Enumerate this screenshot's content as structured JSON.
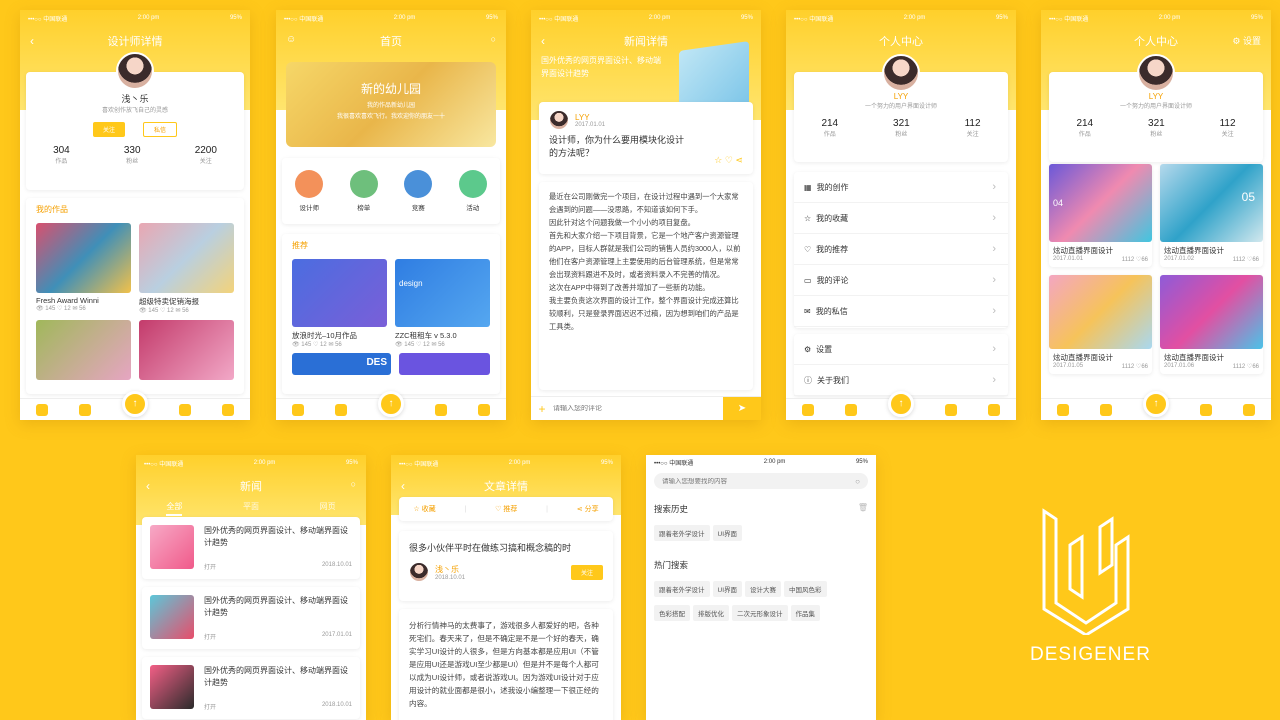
{
  "status": {
    "carrier": "•••○○ 中国联通",
    "time": "2:00 pm",
    "battery": "95%"
  },
  "p1": {
    "title": "设计师详情",
    "name": "浅丶乐",
    "bio": "喜欢创作放飞自己的灵感",
    "follow": "关注",
    "message": "私信",
    "stats": [
      {
        "n": "304",
        "t": "作品"
      },
      {
        "n": "330",
        "t": "粉丝"
      },
      {
        "n": "2200",
        "t": "关注"
      }
    ],
    "section": "我的作品",
    "works": [
      {
        "title": "Fresh Award Winni",
        "views": "145",
        "likes": "12",
        "comments": "56"
      },
      {
        "title": "超级特卖促销海报",
        "views": "145",
        "likes": "12",
        "comments": "56"
      }
    ]
  },
  "p2": {
    "title": "首页",
    "banner_title": "新的幼儿园",
    "banner_sub1": "我的作品新幼儿园",
    "banner_sub2": "我很喜欢喜欢飞行。我欢迎你的朋友一十",
    "cats": [
      "设计师",
      "榜单",
      "竞赛",
      "活动"
    ],
    "section": "推荐",
    "cards": [
      {
        "title": "放浪时光–10月作品",
        "views": "145",
        "likes": "12",
        "comments": "56"
      },
      {
        "title": "ZZC租租车 v 5.3.0",
        "views": "145",
        "likes": "12",
        "comments": "56"
      }
    ],
    "des": "DES",
    "design": "design"
  },
  "p3": {
    "title": "新闻详情",
    "banner": "国外优秀的网页界面设计、移动端界面设计趋势",
    "author": "LYY",
    "date": "2017.01.01",
    "question": "设计师，你为什么要用模块化设计的方法呢？",
    "body": "最近在公司刚做完一个项目，在设计过程中遇到一个大家常会遇到的问题——没思路，不知道该如何下手。\n因此针对这个问题我做一个小小的项目复盘。\n首先和大家介绍一下项目背景，它是一个地产客户资源管理的APP，目标人群就是我们公司的销售人员约3000人，以前他们在客户资源管理上主要使用的后台管理系统，但是常常会出现资料跟进不及时，或者资料录入不完善的情况。\n这次在APP中得到了改善并增加了一些新的功能。\n我主要负责这次界面的设计工作，整个界面设计完成还算比较顺利，只是登录界面迟迟不过稿，因为想到咱们的产品是工具类。",
    "comment_placeholder": "请输入您的评论"
  },
  "p4": {
    "title": "个人中心",
    "name": "LYY",
    "bio": "一个努力的用户界面设计师",
    "stats": [
      {
        "n": "214",
        "t": "作品"
      },
      {
        "n": "321",
        "t": "粉丝"
      },
      {
        "n": "112",
        "t": "关注"
      }
    ],
    "menu": [
      "我的创作",
      "我的收藏",
      "我的推荐",
      "我的评论",
      "我的私信"
    ],
    "menu2": [
      "设置",
      "关于我们"
    ]
  },
  "p5": {
    "title": "个人中心",
    "settings": "设置",
    "name": "LYY",
    "bio": "一个努力的用户界面设计师",
    "stats": [
      {
        "n": "214",
        "t": "作品"
      },
      {
        "n": "321",
        "t": "粉丝"
      },
      {
        "n": "112",
        "t": "关注"
      }
    ],
    "works": [
      {
        "title": "炫动直播界面设计",
        "date": "2017.01.01",
        "views": "1112",
        "likes": "66"
      },
      {
        "title": "炫动直播界面设计",
        "date": "2017.01.02",
        "views": "1112",
        "likes": "66"
      },
      {
        "title": "炫动直播界面设计",
        "date": "2017.01.05",
        "views": "1112",
        "likes": "66"
      },
      {
        "title": "炫动直播界面设计",
        "date": "2017.01.06",
        "views": "1112",
        "likes": "66"
      }
    ],
    "num1": "04",
    "num2": "05"
  },
  "p6": {
    "title": "新闻",
    "tabs": [
      "全部",
      "平面",
      "网页"
    ],
    "items": [
      {
        "title": "国外优秀的网页界面设计、移动端界面设计趋势",
        "tag": "打开",
        "date": "2018.10.01"
      },
      {
        "title": "国外优秀的网页界面设计、移动端界面设计趋势",
        "tag": "打开",
        "date": "2017.01.01"
      },
      {
        "title": "国外优秀的网页界面设计、移动端界面设计趋势",
        "tag": "打开",
        "date": "2018.10.01"
      }
    ]
  },
  "p7": {
    "title": "文章详情",
    "collect": "收藏",
    "recommend": "推荐",
    "share": "分享",
    "headline": "很多小伙伴平时在做练习搞和概念稿的时",
    "author": "浅丶乐",
    "date": "2018.10.01",
    "follow": "关注",
    "body": "分析行情神马的太费事了，游戏很多人都爱好的吧，各种死宅们。春天来了，但是不确定是不是一个好的春天，确实学习UI设计的人很多，但是方向基本都是应用UI（不管是应用UI还是游戏UI至少都是UI）但是并不是每个人都可以成为UI设计师，或者说游戏UI。因为游戏UI设计对于应用设计的就业面都是很小，述我设小编整理一下很正经的内容。"
  },
  "p8": {
    "search_placeholder": "请输入您想要找的内容",
    "history_title": "搜索历史",
    "history": [
      "跟着老外学设计",
      "UI界面"
    ],
    "hot_title": "热门搜索",
    "hot": [
      "跟着老外学设计",
      "UI界面",
      "设计大赛",
      "中国风色彩",
      "色彩搭配",
      "排版优化",
      "二次元形象设计",
      "作品集"
    ]
  },
  "brand": {
    "name": "DESIGENER",
    "accent": "#FFC81A"
  }
}
